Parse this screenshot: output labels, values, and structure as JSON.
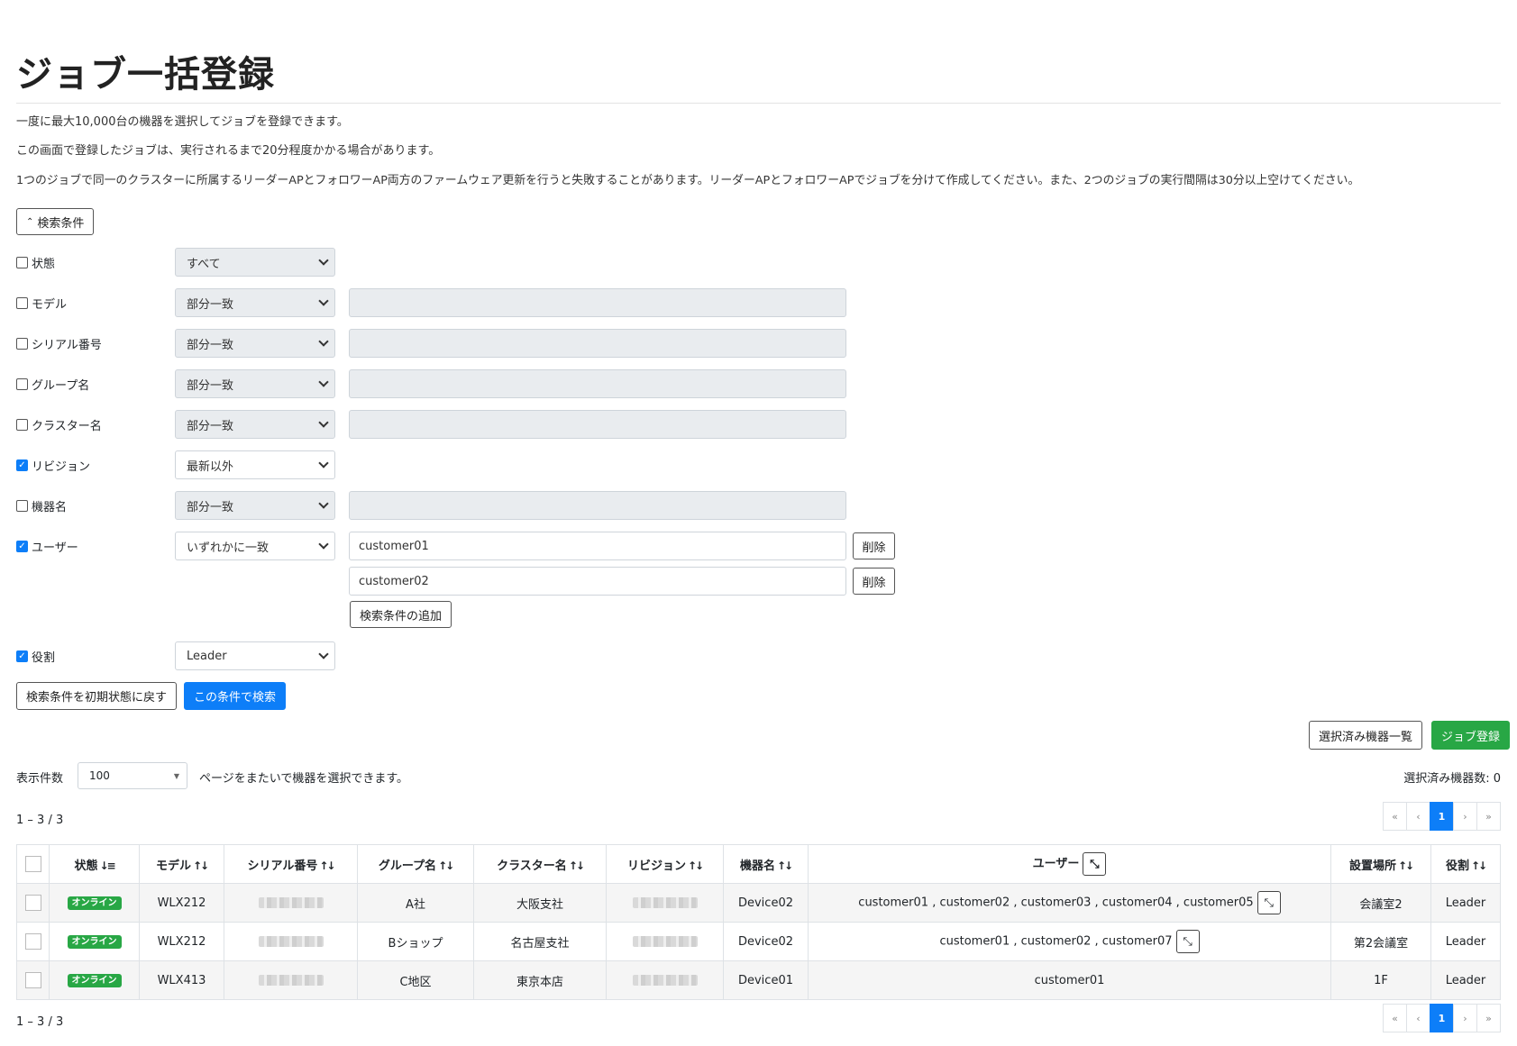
{
  "page": {
    "title": "ジョブ一括登録",
    "desc1": "一度に最大10,000台の機器を選択してジョブを登録できます。",
    "desc2": "この画面で登録したジョブは、実行されるまで20分程度かかる場合があります。",
    "desc3": "1つのジョブで同一のクラスターに所属するリーダーAPとフォロワーAP両方のファームウェア更新を行うと失敗することがあります。リーダーAPとフォロワーAPでジョブを分けて作成してください。また、2つのジョブの実行間隔は30分以上空けてください。"
  },
  "search": {
    "toggle_label": "検索条件",
    "conditions": [
      {
        "label": "状態",
        "checked": false,
        "select": "すべて"
      },
      {
        "label": "モデル",
        "checked": false,
        "select": "部分一致",
        "value": ""
      },
      {
        "label": "シリアル番号",
        "checked": false,
        "select": "部分一致",
        "value": ""
      },
      {
        "label": "グループ名",
        "checked": false,
        "select": "部分一致",
        "value": ""
      },
      {
        "label": "クラスター名",
        "checked": false,
        "select": "部分一致",
        "value": ""
      },
      {
        "label": "リビジョン",
        "checked": true,
        "select": "最新以外"
      },
      {
        "label": "機器名",
        "checked": false,
        "select": "部分一致",
        "value": ""
      },
      {
        "label": "ユーザー",
        "checked": true,
        "select": "いずれかに一致"
      },
      {
        "label": "役割",
        "checked": true,
        "select": "Leader"
      }
    ],
    "user_values": [
      "customer01",
      "customer02"
    ],
    "delete_label": "削除",
    "add_condition_label": "検索条件の追加",
    "reset_label": "検索条件を初期状態に戻す",
    "search_label": "この条件で検索"
  },
  "actions": {
    "selected_list_label": "選択済み機器一覧",
    "register_label": "ジョブ登録",
    "page_size_label": "表示件数",
    "page_size_value": "100",
    "cross_page_note": "ページをまたいで機器を選択できます。",
    "selected_count": "選択済み機器数: 0"
  },
  "pagination": {
    "range": "1 – 3 / 3",
    "first": "«",
    "prev": "‹",
    "current": "1",
    "next": "›",
    "last": "»"
  },
  "table": {
    "headers": {
      "status": "状態",
      "model": "モデル",
      "serial": "シリアル番号",
      "group": "グループ名",
      "cluster": "クラスター名",
      "revision": "リビジョン",
      "device": "機器名",
      "user": "ユーザー",
      "location": "設置場所",
      "role": "役割"
    },
    "rows": [
      {
        "status": "オンライン",
        "model": "WLX212",
        "group": "A社",
        "cluster": "大阪支社",
        "device": "Device02",
        "users": "customer01 , customer02 , customer03 , customer04 , customer05",
        "has_expand": true,
        "location": "会議室2",
        "role": "Leader"
      },
      {
        "status": "オンライン",
        "model": "WLX212",
        "group": "Bショップ",
        "cluster": "名古屋支社",
        "device": "Device02",
        "users": "customer01 , customer02 , customer07",
        "has_expand": true,
        "location": "第2会議室",
        "role": "Leader"
      },
      {
        "status": "オンライン",
        "model": "WLX413",
        "group": "C地区",
        "cluster": "東京本店",
        "device": "Device01",
        "users": "customer01",
        "has_expand": false,
        "location": "1F",
        "role": "Leader"
      }
    ]
  },
  "colors": {
    "primary": "#0d7ef8",
    "success": "#28a745"
  }
}
